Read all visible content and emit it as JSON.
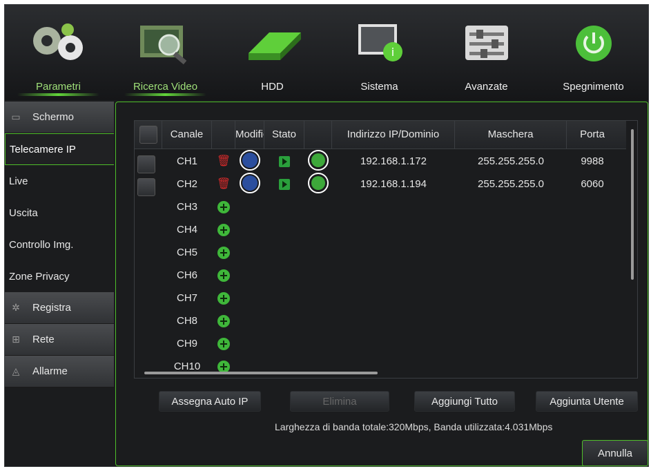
{
  "nav": {
    "items": [
      {
        "label": "Parametri",
        "icon": "gears-icon",
        "active": true
      },
      {
        "label": "Ricerca Video",
        "icon": "video-search-icon",
        "active": true
      },
      {
        "label": "HDD",
        "icon": "hdd-icon",
        "active": false
      },
      {
        "label": "Sistema",
        "icon": "system-info-icon",
        "active": false
      },
      {
        "label": "Avanzate",
        "icon": "sliders-icon",
        "active": false
      },
      {
        "label": "Spegnimento",
        "icon": "power-icon",
        "active": false
      }
    ]
  },
  "sidebar": {
    "items": [
      {
        "label": "Schermo",
        "group": true,
        "icon": "monitor-icon"
      },
      {
        "label": "Telecamere IP",
        "active": true
      },
      {
        "label": "Live"
      },
      {
        "label": "Uscita"
      },
      {
        "label": "Controllo Img."
      },
      {
        "label": "Zone Privacy"
      },
      {
        "label": "Registra",
        "group": true,
        "icon": "record-icon"
      },
      {
        "label": "Rete",
        "group": true,
        "icon": "network-icon"
      },
      {
        "label": "Allarme",
        "group": true,
        "icon": "alarm-icon"
      }
    ]
  },
  "table": {
    "headers": {
      "canale": "Canale",
      "modifica": "Modifica",
      "stato": "Stato",
      "ip": "Indirizzo IP/Dominio",
      "mask": "Maschera",
      "port": "Porta"
    },
    "rows": [
      {
        "channel": "CH1",
        "configured": true,
        "ip": "192.168.1.172",
        "mask": "255.255.255.0",
        "port": "9988"
      },
      {
        "channel": "CH2",
        "configured": true,
        "ip": "192.168.1.194",
        "mask": "255.255.255.0",
        "port": "6060"
      },
      {
        "channel": "CH3",
        "configured": false
      },
      {
        "channel": "CH4",
        "configured": false
      },
      {
        "channel": "CH5",
        "configured": false
      },
      {
        "channel": "CH6",
        "configured": false
      },
      {
        "channel": "CH7",
        "configured": false
      },
      {
        "channel": "CH8",
        "configured": false
      },
      {
        "channel": "CH9",
        "configured": false
      },
      {
        "channel": "CH10",
        "configured": false
      }
    ]
  },
  "buttons": {
    "auto_ip": "Assegna Auto IP",
    "delete": "Elimina",
    "add_all": "Aggiungi Tutto",
    "add_user": "Aggiunta Utente",
    "cancel": "Annulla"
  },
  "bandwidth_text": "Larghezza di banda totale:320Mbps, Banda utilizzata:4.031Mbps",
  "colors": {
    "accent": "#4fbf2a",
    "background": "#1b1c1e",
    "delete": "#d12a2a",
    "add": "#3fb73a"
  }
}
